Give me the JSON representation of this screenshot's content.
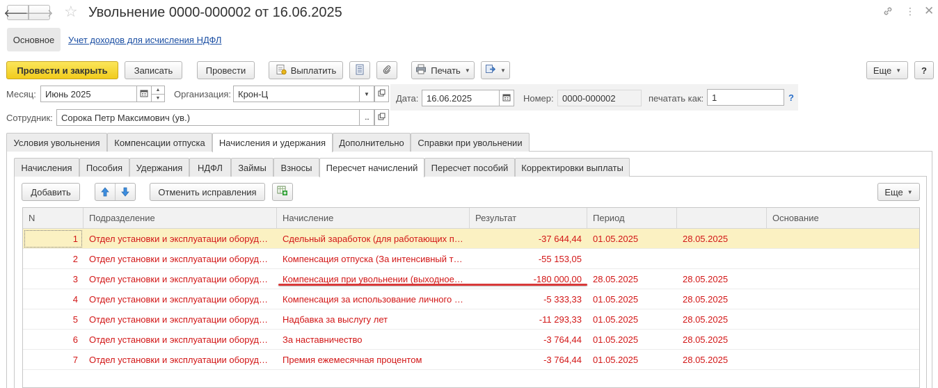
{
  "window": {
    "title": "Увольнение 0000-000002 от 16.06.2025"
  },
  "sections": {
    "active": "Основное",
    "link": "Учет доходов для исчисления НДФЛ"
  },
  "toolbar": {
    "post_close": "Провести и закрыть",
    "save": "Записать",
    "post": "Провести",
    "pay": "Выплатить",
    "print": "Печать",
    "more": "Еще",
    "help": "?"
  },
  "form": {
    "month_label": "Месяц:",
    "month_value": "Июнь 2025",
    "org_label": "Организация:",
    "org_value": "Крон-Ц",
    "date_label": "Дата:",
    "date_value": "16.06.2025",
    "number_label": "Номер:",
    "number_value": "0000-000002",
    "print_as_label": "печатать как:",
    "print_as_value": "1",
    "help_mark": "?",
    "employee_label": "Сотрудник:",
    "employee_value": "Сорока Петр Максимович (ув.)",
    "ellipsis": "..."
  },
  "main_tabs": [
    {
      "label": "Условия увольнения"
    },
    {
      "label": "Компенсации отпуска"
    },
    {
      "label": "Начисления и удержания"
    },
    {
      "label": "Дополнительно"
    },
    {
      "label": "Справки при увольнении"
    }
  ],
  "sub_tabs": [
    {
      "label": "Начисления"
    },
    {
      "label": "Пособия"
    },
    {
      "label": "Удержания"
    },
    {
      "label": "НДФЛ"
    },
    {
      "label": "Займы"
    },
    {
      "label": "Взносы"
    },
    {
      "label": "Пересчет начислений"
    },
    {
      "label": "Пересчет пособий"
    },
    {
      "label": "Корректировки выплаты"
    }
  ],
  "table_toolbar": {
    "add": "Добавить",
    "cancel_corrections": "Отменить исправления",
    "more": "Еще"
  },
  "table": {
    "columns": [
      "N",
      "Подразделение",
      "Начисление",
      "Результат",
      "Период",
      "",
      "Основание"
    ],
    "rows": [
      {
        "n": "1",
        "dept": "Отдел установки и эксплуатации оборуд…",
        "accrual": "Сдельный заработок (для работающих п…",
        "result": "-37 644,44",
        "from": "01.05.2025",
        "to": "28.05.2025",
        "basis": ""
      },
      {
        "n": "2",
        "dept": "Отдел установки и эксплуатации оборуд…",
        "accrual": "Компенсация отпуска (За интенсивный т…",
        "result": "-55 153,05",
        "from": "",
        "to": "",
        "basis": ""
      },
      {
        "n": "3",
        "dept": "Отдел установки и эксплуатации оборуд…",
        "accrual": "Компенсация при увольнении (выходное…",
        "result": "-180 000,00",
        "from": "28.05.2025",
        "to": "28.05.2025",
        "basis": ""
      },
      {
        "n": "4",
        "dept": "Отдел установки и эксплуатации оборуд…",
        "accrual": "Компенсация за использование личного …",
        "result": "-5 333,33",
        "from": "01.05.2025",
        "to": "28.05.2025",
        "basis": ""
      },
      {
        "n": "5",
        "dept": "Отдел установки и эксплуатации оборуд…",
        "accrual": "Надбавка за выслугу лет",
        "result": "-11 293,33",
        "from": "01.05.2025",
        "to": "28.05.2025",
        "basis": ""
      },
      {
        "n": "6",
        "dept": "Отдел установки и эксплуатации оборуд…",
        "accrual": "За наставничество",
        "result": "-3 764,44",
        "from": "01.05.2025",
        "to": "28.05.2025",
        "basis": ""
      },
      {
        "n": "7",
        "dept": "Отдел установки и эксплуатации оборуд…",
        "accrual": "Премия ежемесячная процентом",
        "result": "-3 764,44",
        "from": "01.05.2025",
        "to": "28.05.2025",
        "basis": ""
      }
    ]
  },
  "colors": {
    "row_text": "#d21616",
    "selected_row": "#fbf1c2",
    "primary_button": "#f5d52a",
    "link": "#1a4ea3",
    "highlight_underline": "#d83838"
  }
}
